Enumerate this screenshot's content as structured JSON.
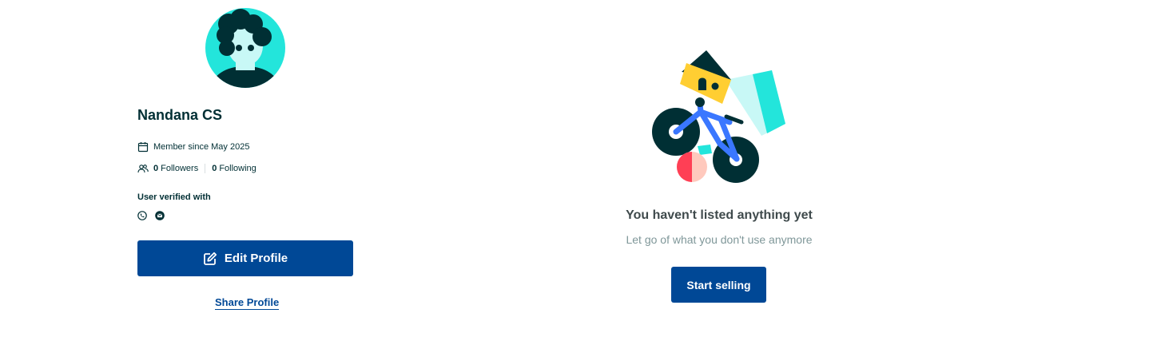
{
  "profile": {
    "name": "Nandana CS",
    "member_since": "Member since May 2025",
    "followers_count": "0",
    "followers_label": "Followers",
    "following_count": "0",
    "following_label": "Following",
    "verified_label": "User verified with",
    "verified_icons": [
      "phone-icon",
      "email-icon"
    ],
    "edit_button": "Edit Profile",
    "share_link": "Share Profile"
  },
  "empty_state": {
    "title": "You haven't listed anything yet",
    "subtitle": "Let go of what you don't use anymore",
    "cta": "Start selling"
  },
  "colors": {
    "primary": "#004896",
    "text_dark": "#002f34",
    "teal": "#23e5db",
    "yellow": "#ffce32",
    "bike_blue": "#3a77ff",
    "muted": "#7f9799"
  }
}
